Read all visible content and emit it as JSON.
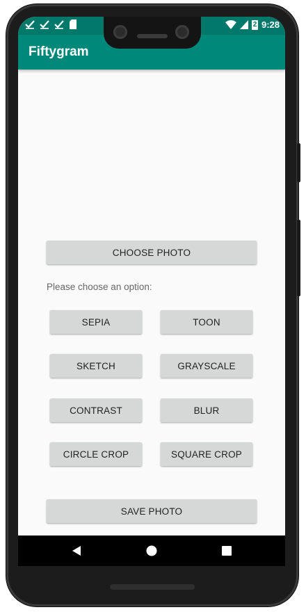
{
  "status_bar": {
    "time": "9:28",
    "battery_level": "2",
    "notification_icons": [
      "check-icon",
      "check-icon",
      "check-icon",
      "sd-card-icon"
    ],
    "right_icons": [
      "wifi-icon",
      "cell-signal-icon",
      "battery-icon"
    ]
  },
  "app_bar": {
    "title": "Fiftygram"
  },
  "main": {
    "choose_photo_label": "CHOOSE PHOTO",
    "prompt": "Please choose an option:",
    "filters": {
      "sepia": "SEPIA",
      "toon": "TOON",
      "sketch": "SKETCH",
      "grayscale": "GRAYSCALE",
      "contrast": "CONTRAST",
      "blur": "BLUR",
      "circle_crop": "CIRCLE CROP",
      "square_crop": "SQUARE CROP"
    },
    "save_photo_label": "SAVE PHOTO"
  },
  "nav_bar": {
    "icons": [
      "back-icon",
      "home-icon",
      "recents-icon"
    ]
  },
  "colors": {
    "status_bar": "#00796b",
    "app_bar": "#00897b",
    "button_bg": "#d6d7d7",
    "background": "#fafafa"
  }
}
